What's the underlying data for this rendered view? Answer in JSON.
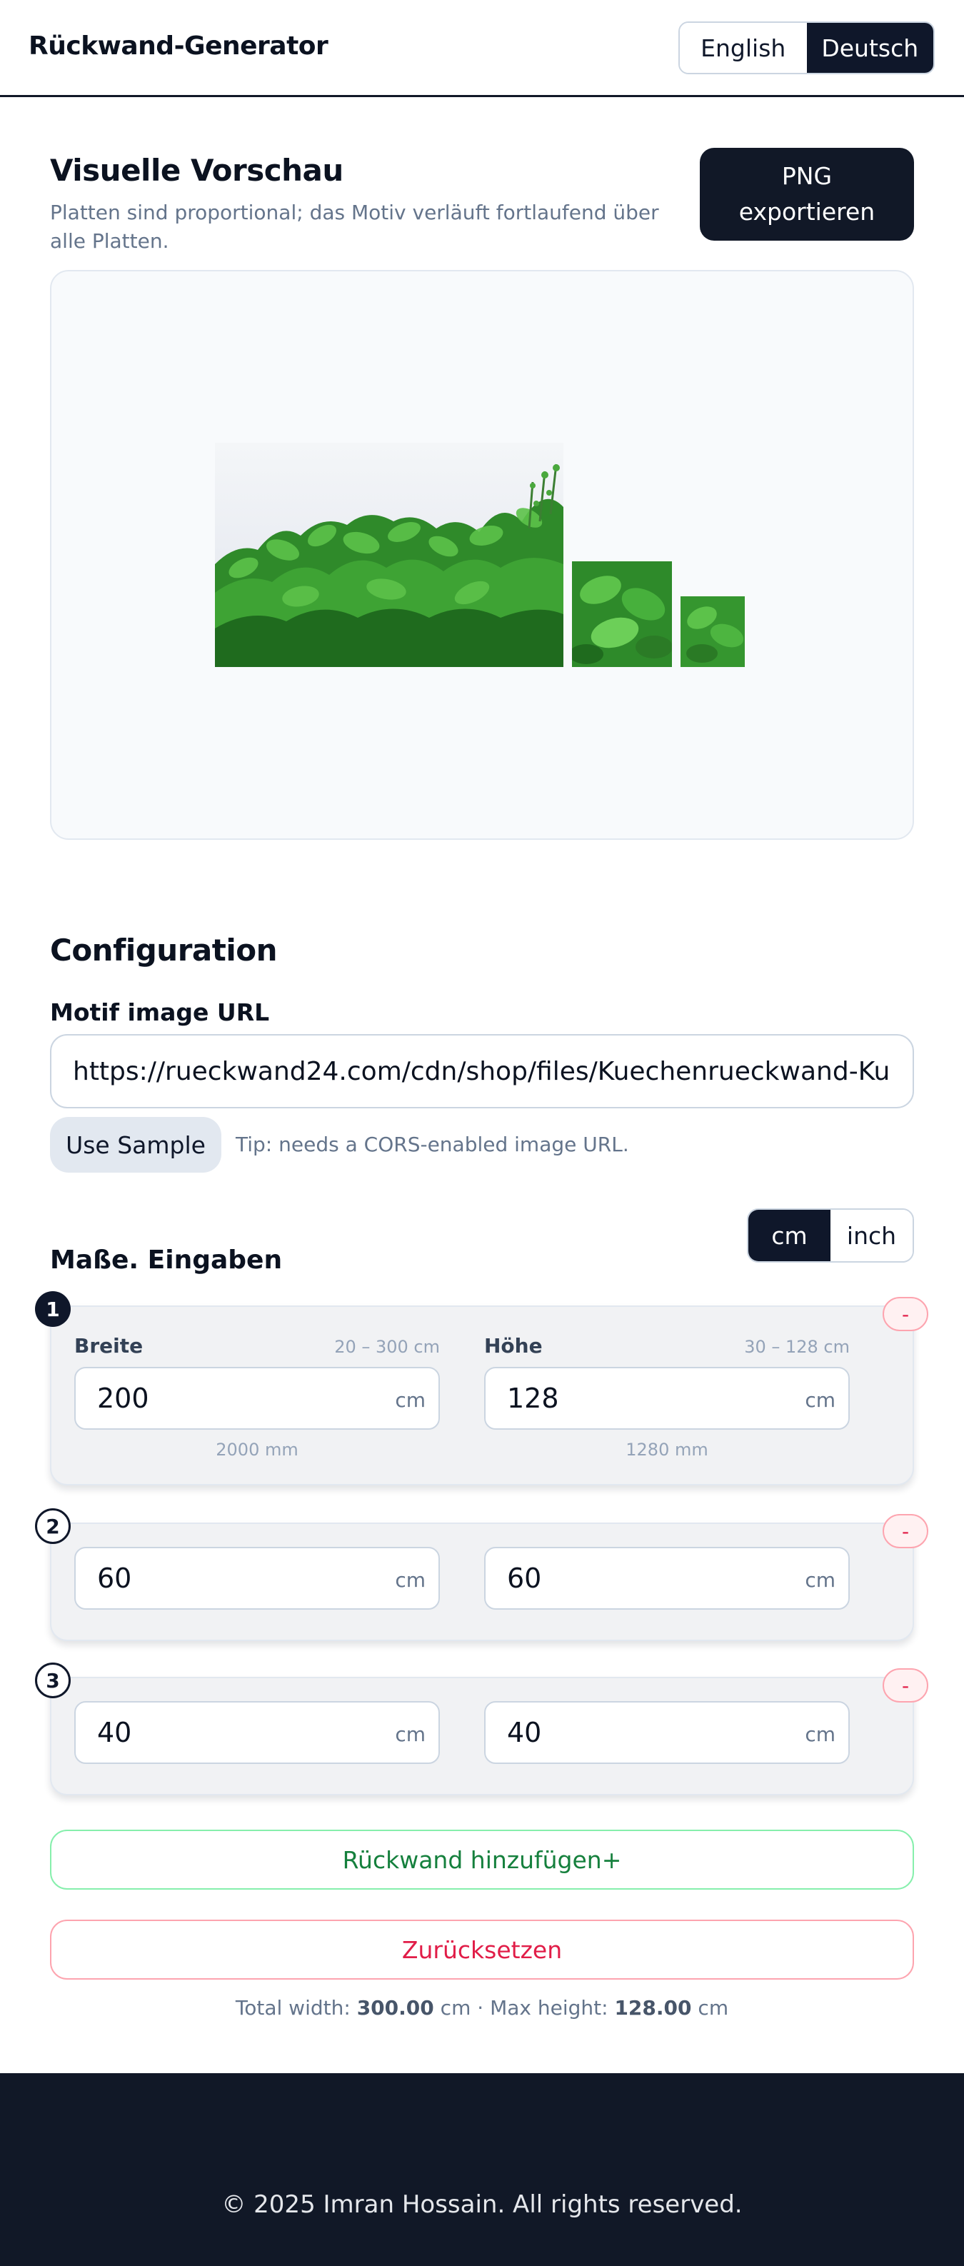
{
  "header": {
    "title": "Rückwand-Generator",
    "languages": [
      {
        "label": "English",
        "active": false
      },
      {
        "label": "Deutsch",
        "active": true
      }
    ]
  },
  "preview": {
    "title": "Visuelle Vorschau",
    "subtitle": "Platten sind proportional; das Motiv verläuft fortlaufend über alle Platten.",
    "export_label_line1": "PNG",
    "export_label_line2": "exportieren"
  },
  "config": {
    "title": "Configuration",
    "motif_label": "Motif image URL",
    "motif_url": "https://rueckwand24.com/cdn/shop/files/Kuechenrueckwand-Kuechenrueckwand-Gruene-Frische-Kraeuter.jpg",
    "sample_label": "Use Sample",
    "tip": "Tip: needs a CORS-enabled image URL.",
    "units": [
      {
        "label": "cm",
        "active": true
      },
      {
        "label": "inch",
        "active": false
      }
    ],
    "dims_title": "Maße. Eingaben",
    "width_label": "Breite",
    "width_range": "20 – 300 cm",
    "height_label": "Höhe",
    "height_range": "30 – 128 cm",
    "unit_suffix": "cm",
    "remove_label": "-"
  },
  "panels": [
    {
      "index": "1",
      "width": "200",
      "height": "128",
      "width_mm": "2000 mm",
      "height_mm": "1280 mm"
    },
    {
      "index": "2",
      "width": "60",
      "height": "60"
    },
    {
      "index": "3",
      "width": "40",
      "height": "40"
    }
  ],
  "actions": {
    "add_label": "Rückwand hinzufügen+",
    "reset_label": "Zurücksetzen"
  },
  "totals": {
    "width_prefix": "Total width:",
    "width_value": "300.00",
    "width_unit": "cm ·",
    "height_prefix": "Max height:",
    "height_value": "128.00",
    "height_unit": "cm"
  },
  "footer": {
    "copyright": "© 2025 Imran Hossain. All rights reserved."
  },
  "colors": {
    "primary": "#0f172a",
    "muted_text": "#64748b",
    "add_green": "#15803d",
    "reset_red": "#e11d48",
    "footer_bg": "#111827",
    "herb_green": "#2e8b2e"
  }
}
